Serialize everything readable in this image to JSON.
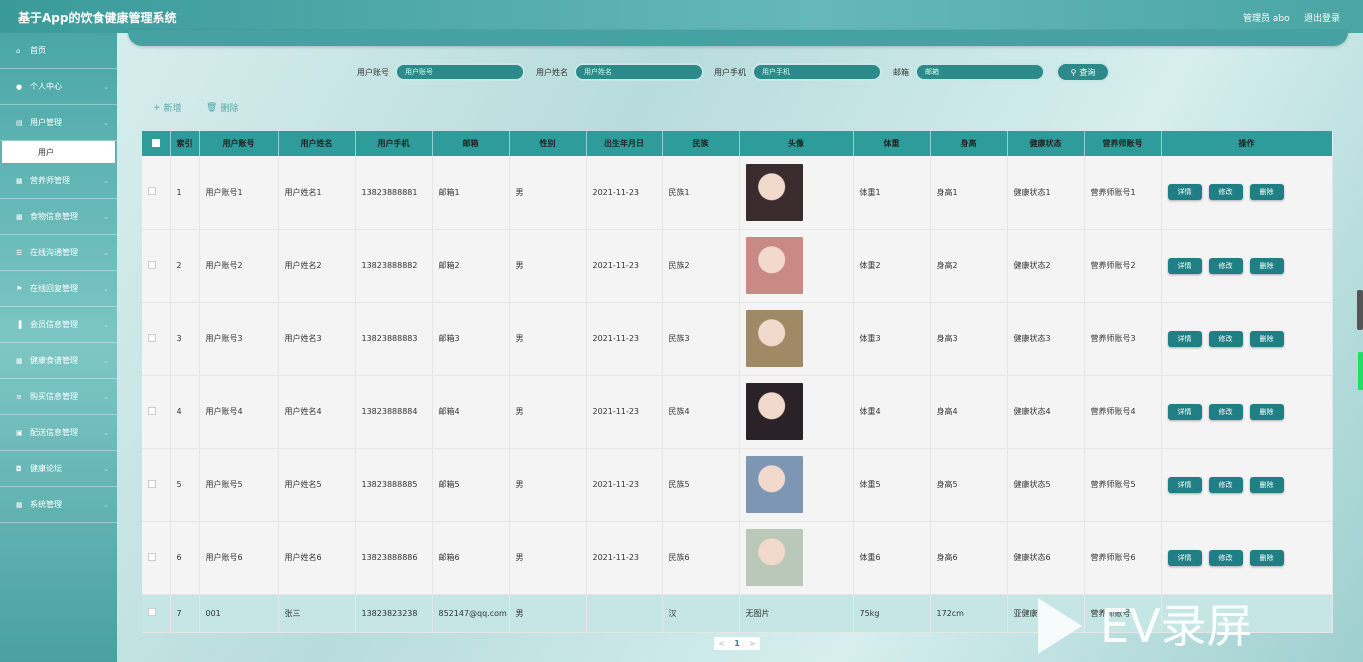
{
  "header": {
    "title": "基于App的饮食健康管理系统",
    "admin": "管理员 abo",
    "logout": "退出登录"
  },
  "sidebar": {
    "items": [
      {
        "label": "首页",
        "icon": "home-icon"
      },
      {
        "label": "个人中心",
        "icon": "user-icon"
      },
      {
        "label": "用户管理",
        "icon": "doc-icon"
      },
      {
        "label": "营养师管理",
        "icon": "grid-icon"
      },
      {
        "label": "食物信息管理",
        "icon": "grid-icon"
      },
      {
        "label": "在线沟通管理",
        "icon": "sliders-icon"
      },
      {
        "label": "在线回复管理",
        "icon": "flag-icon"
      },
      {
        "label": "会员信息管理",
        "icon": "chart-icon"
      },
      {
        "label": "健康食谱管理",
        "icon": "grid-icon"
      },
      {
        "label": "购买信息管理",
        "icon": "list-icon"
      },
      {
        "label": "配送信息管理",
        "icon": "box-icon"
      },
      {
        "label": "健康论坛",
        "icon": "forum-icon"
      },
      {
        "label": "系统管理",
        "icon": "grid-icon"
      }
    ],
    "sub_item": "用户"
  },
  "search": {
    "fields": [
      {
        "label": "用户账号",
        "placeholder": "用户账号"
      },
      {
        "label": "用户姓名",
        "placeholder": "用户姓名"
      },
      {
        "label": "用户手机",
        "placeholder": "用户手机"
      },
      {
        "label": "邮箱",
        "placeholder": "邮箱"
      }
    ],
    "query_button": "查询"
  },
  "actions": {
    "add": "新增",
    "delete": "删除"
  },
  "table": {
    "headers": [
      "索引",
      "用户账号",
      "用户姓名",
      "用户手机",
      "邮箱",
      "性别",
      "出生年月日",
      "民族",
      "头像",
      "体重",
      "身高",
      "健康状态",
      "营养师账号",
      "操作"
    ],
    "rows": [
      {
        "idx": "1",
        "acct": "用户账号1",
        "name": "用户姓名1",
        "phone": "13823888881",
        "email": "邮箱1",
        "sex": "男",
        "birth": "2021-11-23",
        "nation": "民族1",
        "weight": "体重1",
        "height": "身高1",
        "health": "健康状态1",
        "nutri": "营养师账号1",
        "avatar_color": "#3a2c2e"
      },
      {
        "idx": "2",
        "acct": "用户账号2",
        "name": "用户姓名2",
        "phone": "13823888882",
        "email": "邮箱2",
        "sex": "男",
        "birth": "2021-11-23",
        "nation": "民族2",
        "weight": "体重2",
        "height": "身高2",
        "health": "健康状态2",
        "nutri": "营养师账号2",
        "avatar_color": "#c98a86"
      },
      {
        "idx": "3",
        "acct": "用户账号3",
        "name": "用户姓名3",
        "phone": "13823888883",
        "email": "邮箱3",
        "sex": "男",
        "birth": "2021-11-23",
        "nation": "民族3",
        "weight": "体重3",
        "height": "身高3",
        "health": "健康状态3",
        "nutri": "营养师账号3",
        "avatar_color": "#a08a66"
      },
      {
        "idx": "4",
        "acct": "用户账号4",
        "name": "用户姓名4",
        "phone": "13823888884",
        "email": "邮箱4",
        "sex": "男",
        "birth": "2021-11-23",
        "nation": "民族4",
        "weight": "体重4",
        "height": "身高4",
        "health": "健康状态4",
        "nutri": "营养师账号4",
        "avatar_color": "#2a2226"
      },
      {
        "idx": "5",
        "acct": "用户账号5",
        "name": "用户姓名5",
        "phone": "13823888885",
        "email": "邮箱5",
        "sex": "男",
        "birth": "2021-11-23",
        "nation": "民族5",
        "weight": "体重5",
        "height": "身高5",
        "health": "健康状态5",
        "nutri": "营养师账号5",
        "avatar_color": "#7d96b4"
      },
      {
        "idx": "6",
        "acct": "用户账号6",
        "name": "用户姓名6",
        "phone": "13823888886",
        "email": "邮箱6",
        "sex": "男",
        "birth": "2021-11-23",
        "nation": "民族6",
        "weight": "体重6",
        "height": "身高6",
        "health": "健康状态6",
        "nutri": "营养师账号6",
        "avatar_color": "#b9c8b8"
      }
    ],
    "last_row": {
      "idx": "7",
      "acct": "001",
      "name": "张三",
      "phone": "13823823238",
      "email": "852147@qq.com",
      "sex": "男",
      "birth": "",
      "nation": "汉",
      "avatar": "无图片",
      "weight": "75kg",
      "height": "172cm",
      "health": "亚健康",
      "nutri": "营养师账号"
    },
    "row_buttons": {
      "detail": "详情",
      "edit": "修改",
      "delete": "删除"
    }
  },
  "pagination": {
    "prev": "<",
    "current": "1",
    "next": ">"
  },
  "watermark": "EV录屏"
}
